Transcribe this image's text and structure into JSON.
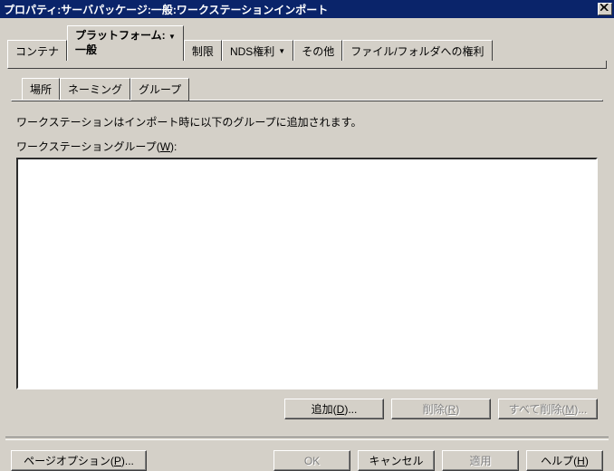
{
  "title": "プロパティ:サーバパッケージ:一般:ワークステーションインポート",
  "top_tabs": {
    "container": "コンテナ",
    "platform_line1": "プラットフォーム:",
    "platform_line2": "一般",
    "limit": "制限",
    "nds": "NDS権利",
    "other": "その他",
    "filefolder": "ファイル/フォルダへの権利"
  },
  "sub_tabs": {
    "location": "場所",
    "naming": "ネーミング",
    "group": "グループ"
  },
  "body": {
    "desc": "ワークステーションはインポート時に以下のグループに追加されます。",
    "group_label": "ワークステーショングループ",
    "group_accel": "(W)",
    "colon": ":"
  },
  "buttons": {
    "add": "追加",
    "add_accel": "(D)",
    "delete": "削除",
    "delete_accel": "(R)",
    "delete_all": "すべて削除",
    "delete_all_accel": "(M)"
  },
  "bottom": {
    "page_options": "ページオプション",
    "page_options_accel": "(P)",
    "ok": "OK",
    "cancel": "キャンセル",
    "apply": "適用",
    "help": "ヘルプ",
    "help_accel": "(H)"
  }
}
